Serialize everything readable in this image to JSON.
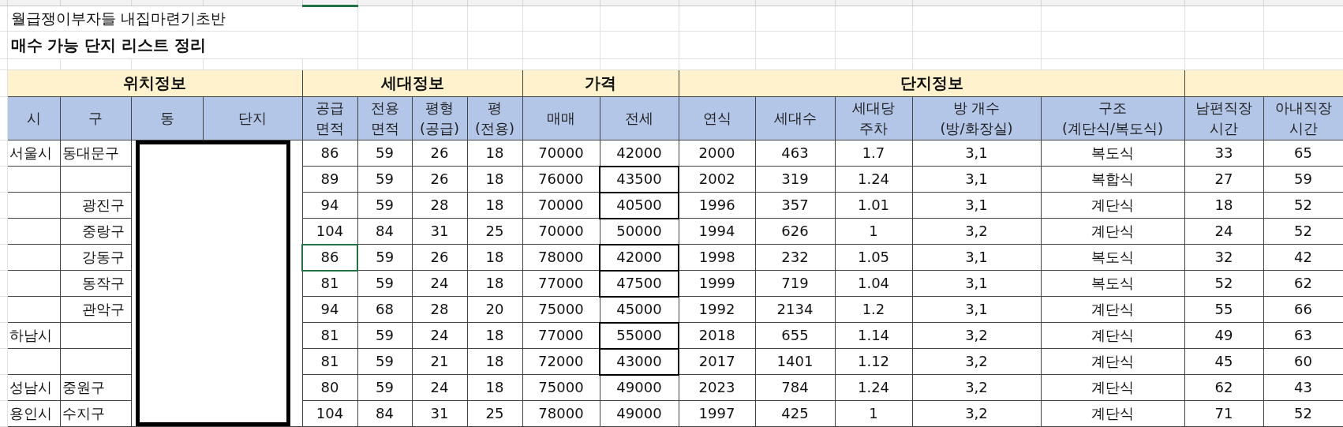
{
  "title": "월급쟁이부자들 내집마련기초반",
  "subtitle": "매수 가능 단지 리스트 정리",
  "groups": [
    {
      "label": "위치정보"
    },
    {
      "label": "세대정보"
    },
    {
      "label": "가격"
    },
    {
      "label": "단지정보"
    }
  ],
  "columns": [
    "시",
    "구",
    "동",
    "단지",
    "공급\n면적",
    "전용\n면적",
    "평형\n(공급)",
    "평\n(전용)",
    "매매",
    "전세",
    "연식",
    "세대수",
    "세대당\n주차",
    "방 개수\n(방/화장실)",
    "구조\n(계단식/복도식)",
    "남편직장\n시간",
    "아내직장\n시간"
  ],
  "rows": [
    {
      "si": "서울시",
      "gu": "동대문구",
      "values": [
        "86",
        "59",
        "26",
        "18",
        "70000",
        "42000",
        "2000",
        "463",
        "1.7",
        "3,1",
        "복도식",
        "33",
        "65"
      ],
      "jeonse_outlined": false,
      "supply_selected": false
    },
    {
      "values": [
        "89",
        "59",
        "26",
        "18",
        "76000",
        "43500",
        "2002",
        "319",
        "1.24",
        "3,1",
        "복합식",
        "27",
        "59"
      ],
      "jeonse_outlined": true,
      "supply_selected": false
    },
    {
      "gu": "광진구",
      "values": [
        "94",
        "59",
        "28",
        "18",
        "70000",
        "40500",
        "1996",
        "357",
        "1.01",
        "3,1",
        "계단식",
        "18",
        "52"
      ],
      "jeonse_outlined": true,
      "supply_selected": false
    },
    {
      "gu": "중랑구",
      "values": [
        "104",
        "84",
        "31",
        "25",
        "70000",
        "50000",
        "1994",
        "626",
        "1",
        "3,2",
        "계단식",
        "24",
        "52"
      ],
      "jeonse_outlined": false,
      "supply_selected": false
    },
    {
      "gu": "강동구",
      "values": [
        "86",
        "59",
        "26",
        "18",
        "78000",
        "42000",
        "1998",
        "232",
        "1.05",
        "3,1",
        "복도식",
        "32",
        "42"
      ],
      "jeonse_outlined": true,
      "supply_selected": true
    },
    {
      "gu": "동작구",
      "values": [
        "81",
        "59",
        "24",
        "18",
        "77000",
        "47500",
        "1999",
        "719",
        "1.04",
        "3,1",
        "복도식",
        "52",
        "62"
      ],
      "jeonse_outlined": true,
      "supply_selected": false
    },
    {
      "gu": "관악구",
      "values": [
        "94",
        "68",
        "28",
        "20",
        "75000",
        "45000",
        "1992",
        "2134",
        "1.2",
        "3,1",
        "계단식",
        "55",
        "66"
      ],
      "jeonse_outlined": false,
      "supply_selected": false
    },
    {
      "si": "하남시",
      "values": [
        "81",
        "59",
        "24",
        "18",
        "77000",
        "55000",
        "2018",
        "655",
        "1.14",
        "3,2",
        "계단식",
        "49",
        "63"
      ],
      "jeonse_outlined": true,
      "supply_selected": false
    },
    {
      "values": [
        "81",
        "59",
        "21",
        "18",
        "72000",
        "43000",
        "2017",
        "1401",
        "1.12",
        "3,2",
        "계단식",
        "45",
        "60"
      ],
      "jeonse_outlined": true,
      "supply_selected": false
    },
    {
      "si": "성남시",
      "gu": "중원구",
      "values": [
        "80",
        "59",
        "24",
        "18",
        "75000",
        "49000",
        "2023",
        "784",
        "1.24",
        "3,2",
        "계단식",
        "62",
        "43"
      ],
      "jeonse_outlined": false,
      "supply_selected": false
    },
    {
      "si": "용인시",
      "gu": "수지구",
      "values": [
        "104",
        "84",
        "31",
        "25",
        "78000",
        "49000",
        "1997",
        "425",
        "1",
        "3,2",
        "계단식",
        "71",
        "52"
      ],
      "jeonse_outlined": false,
      "supply_selected": false
    }
  ]
}
